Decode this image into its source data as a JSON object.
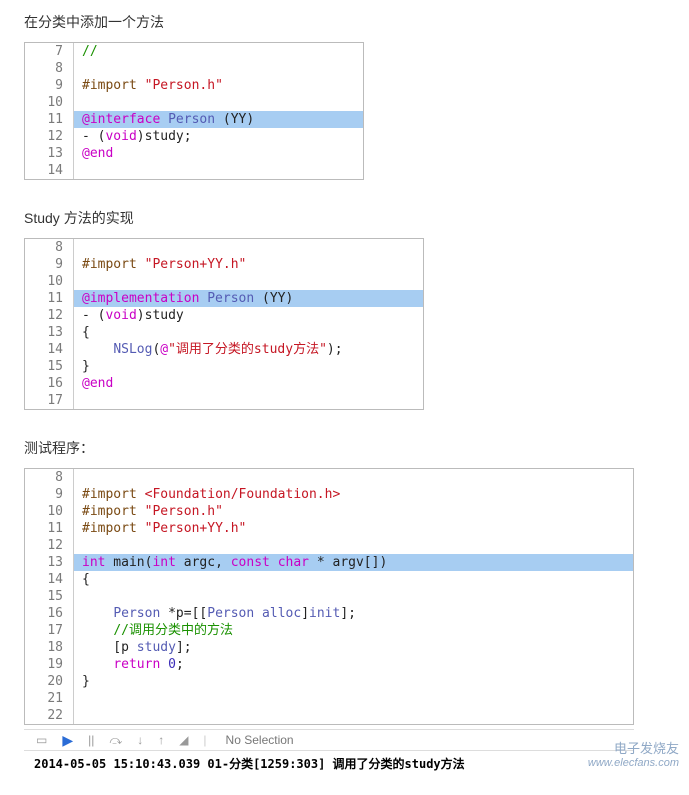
{
  "sections": {
    "s1_title": "在分类中添加一个方法",
    "s2_title": "Study 方法的实现",
    "s3_title": "测试程序："
  },
  "block1": {
    "lines": [
      {
        "n": "7",
        "hl": false,
        "tokens": [
          [
            "cmt",
            "//"
          ]
        ]
      },
      {
        "n": "8",
        "hl": false,
        "tokens": []
      },
      {
        "n": "9",
        "hl": false,
        "tokens": [
          [
            "dir",
            "#import "
          ],
          [
            "str",
            "\"Person.h\""
          ]
        ]
      },
      {
        "n": "10",
        "hl": false,
        "tokens": []
      },
      {
        "n": "11",
        "hl": true,
        "tokens": [
          [
            "kw",
            "@interface"
          ],
          [
            "plain",
            " "
          ],
          [
            "typ",
            "Person"
          ],
          [
            "plain",
            " (YY)"
          ]
        ]
      },
      {
        "n": "12",
        "hl": false,
        "tokens": [
          [
            "plain",
            "- ("
          ],
          [
            "kw",
            "void"
          ],
          [
            "plain",
            ")study;"
          ]
        ]
      },
      {
        "n": "13",
        "hl": false,
        "tokens": [
          [
            "kw",
            "@end"
          ]
        ]
      },
      {
        "n": "14",
        "hl": false,
        "tokens": []
      }
    ]
  },
  "block2": {
    "lines": [
      {
        "n": "8",
        "hl": false,
        "tokens": []
      },
      {
        "n": "9",
        "hl": false,
        "tokens": [
          [
            "dir",
            "#import "
          ],
          [
            "str",
            "\"Person+YY.h\""
          ]
        ]
      },
      {
        "n": "10",
        "hl": false,
        "tokens": []
      },
      {
        "n": "11",
        "hl": true,
        "tokens": [
          [
            "kw",
            "@implementation"
          ],
          [
            "plain",
            " "
          ],
          [
            "typ",
            "Person"
          ],
          [
            "plain",
            " (YY)"
          ]
        ]
      },
      {
        "n": "12",
        "hl": false,
        "tokens": [
          [
            "plain",
            "- ("
          ],
          [
            "kw",
            "void"
          ],
          [
            "plain",
            ")study"
          ]
        ]
      },
      {
        "n": "13",
        "hl": false,
        "tokens": [
          [
            "plain",
            "{"
          ]
        ]
      },
      {
        "n": "14",
        "hl": false,
        "tokens": [
          [
            "plain",
            "    "
          ],
          [
            "typ",
            "NSLog"
          ],
          [
            "plain",
            "("
          ],
          [
            "kw",
            "@"
          ],
          [
            "str",
            "\"调用了分类的study方法\""
          ],
          [
            "plain",
            ");"
          ]
        ]
      },
      {
        "n": "15",
        "hl": false,
        "tokens": [
          [
            "plain",
            "}"
          ]
        ]
      },
      {
        "n": "16",
        "hl": false,
        "tokens": [
          [
            "kw",
            "@end"
          ]
        ]
      },
      {
        "n": "17",
        "hl": false,
        "tokens": []
      }
    ]
  },
  "block3": {
    "lines": [
      {
        "n": "8",
        "hl": false,
        "tokens": []
      },
      {
        "n": "9",
        "hl": false,
        "tokens": [
          [
            "dir",
            "#import "
          ],
          [
            "str",
            "<Foundation/Foundation.h>"
          ]
        ]
      },
      {
        "n": "10",
        "hl": false,
        "tokens": [
          [
            "dir",
            "#import "
          ],
          [
            "str",
            "\"Person.h\""
          ]
        ]
      },
      {
        "n": "11",
        "hl": false,
        "tokens": [
          [
            "dir",
            "#import "
          ],
          [
            "str",
            "\"Person+YY.h\""
          ]
        ]
      },
      {
        "n": "12",
        "hl": false,
        "tokens": []
      },
      {
        "n": "13",
        "hl": true,
        "tokens": [
          [
            "kw",
            "int"
          ],
          [
            "plain",
            " main("
          ],
          [
            "kw",
            "int"
          ],
          [
            "plain",
            " argc, "
          ],
          [
            "kw",
            "const"
          ],
          [
            "plain",
            " "
          ],
          [
            "kw",
            "char"
          ],
          [
            "plain",
            " * argv[])"
          ]
        ]
      },
      {
        "n": "14",
        "hl": false,
        "tokens": [
          [
            "plain",
            "{"
          ]
        ]
      },
      {
        "n": "15",
        "hl": false,
        "tokens": []
      },
      {
        "n": "16",
        "hl": false,
        "tokens": [
          [
            "plain",
            "    "
          ],
          [
            "typ",
            "Person"
          ],
          [
            "plain",
            " *p=[["
          ],
          [
            "typ",
            "Person"
          ],
          [
            "plain",
            " "
          ],
          [
            "typ",
            "alloc"
          ],
          [
            "plain",
            "]"
          ],
          [
            "typ",
            "init"
          ],
          [
            "plain",
            "];"
          ]
        ]
      },
      {
        "n": "17",
        "hl": false,
        "tokens": [
          [
            "plain",
            "    "
          ],
          [
            "cmt",
            "//调用分类中的方法"
          ]
        ]
      },
      {
        "n": "18",
        "hl": false,
        "tokens": [
          [
            "plain",
            "    [p "
          ],
          [
            "typ",
            "study"
          ],
          [
            "plain",
            "];"
          ]
        ]
      },
      {
        "n": "19",
        "hl": false,
        "tokens": [
          [
            "plain",
            "    "
          ],
          [
            "kw",
            "return"
          ],
          [
            "plain",
            " "
          ],
          [
            "num",
            "0"
          ],
          [
            "plain",
            ";"
          ]
        ]
      },
      {
        "n": "20",
        "hl": false,
        "tokens": [
          [
            "plain",
            "}"
          ]
        ]
      },
      {
        "n": "21",
        "hl": false,
        "tokens": []
      },
      {
        "n": "22",
        "hl": false,
        "tokens": []
      }
    ]
  },
  "toolbar": {
    "no_selection": "No Selection"
  },
  "console": {
    "output": "2014-05-05 15:10:43.039 01-分类[1259:303] 调用了分类的study方法"
  },
  "watermark": {
    "line1": "电子发烧友",
    "line2": "www.elecfans.com"
  }
}
